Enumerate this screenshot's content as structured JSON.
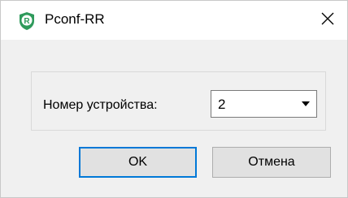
{
  "window": {
    "title": "Pconf-RR",
    "icon": "app-logo-icon",
    "close_icon": "close-icon"
  },
  "form": {
    "device_label": "Номер устройства:",
    "device_value": "2",
    "dropdown_icon": "chevron-down-icon"
  },
  "buttons": {
    "ok_label": "OK",
    "cancel_label": "Отмена"
  },
  "colors": {
    "focus_border": "#0078d7",
    "button_bg": "#e1e1e1",
    "logo_green": "#2e9a5b"
  }
}
